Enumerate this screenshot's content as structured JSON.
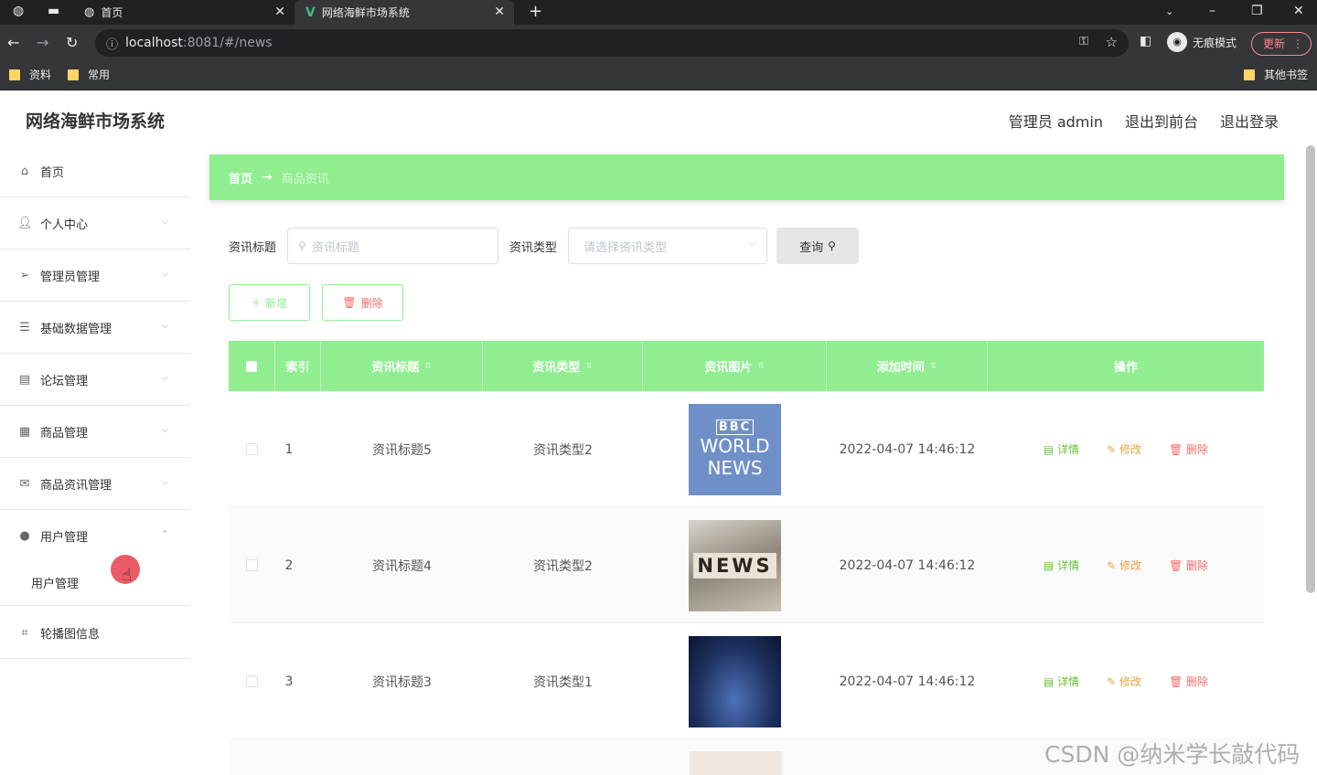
{
  "browser": {
    "tabs": [
      {
        "label": "首页"
      },
      {
        "label": "网络海鲜市场系统"
      }
    ],
    "url_host": "localhost",
    "url_rest": ":8081/#/news",
    "incognito_label": "无痕模式",
    "update_label": "更新",
    "bookmarks": [
      "资料",
      "常用"
    ],
    "other_bookmarks": "其他书签"
  },
  "header": {
    "title": "网络海鲜市场系统",
    "admin_label": "管理员 admin",
    "front_label": "退出到前台",
    "logout_label": "退出登录"
  },
  "sidebar": {
    "items": [
      {
        "label": "首页",
        "icon": "home-icon"
      },
      {
        "label": "个人中心",
        "icon": "user-icon"
      },
      {
        "label": "管理员管理",
        "icon": "send-icon"
      },
      {
        "label": "基础数据管理",
        "icon": "sliders-icon"
      },
      {
        "label": "论坛管理",
        "icon": "document-icon"
      },
      {
        "label": "商品管理",
        "icon": "grid-icon"
      },
      {
        "label": "商品资讯管理",
        "icon": "mail-icon"
      },
      {
        "label": "用户管理",
        "icon": "bulb-icon"
      },
      {
        "label": "轮播图信息",
        "icon": "crop-icon"
      }
    ],
    "submenu_label": "用户管理"
  },
  "breadcrumb": {
    "home": "首页",
    "current": "商品资讯"
  },
  "search": {
    "title_label": "资讯标题",
    "title_placeholder": "资讯标题",
    "type_label": "资讯类型",
    "type_placeholder": "请选择资讯类型",
    "query_label": "查询"
  },
  "toolbar": {
    "add_label": "新增",
    "delete_label": "删除"
  },
  "table": {
    "headers": [
      "索引",
      "资讯标题",
      "资讯类型",
      "资讯图片",
      "添加时间",
      "操作"
    ],
    "rows": [
      {
        "index": "1",
        "title": "资讯标题5",
        "type": "资讯类型2",
        "time": "2022-04-07 14:46:12"
      },
      {
        "index": "2",
        "title": "资讯标题4",
        "type": "资讯类型2",
        "time": "2022-04-07 14:46:12"
      },
      {
        "index": "3",
        "title": "资讯标题3",
        "type": "资讯类型1",
        "time": "2022-04-07 14:46:12"
      }
    ],
    "action_detail": "详情",
    "action_edit": "修改",
    "action_delete": "删除"
  },
  "images": {
    "bbc_top": "BBC",
    "bbc_line1": "WORLD",
    "bbc_line2": "NEWS",
    "news_letters": "NEWS"
  },
  "watermark": "CSDN @纳米学长敲代码",
  "colors": {
    "accent": "#90ee90",
    "danger": "#f56c6c",
    "success": "#67c23a",
    "warning": "#e6a23c"
  }
}
